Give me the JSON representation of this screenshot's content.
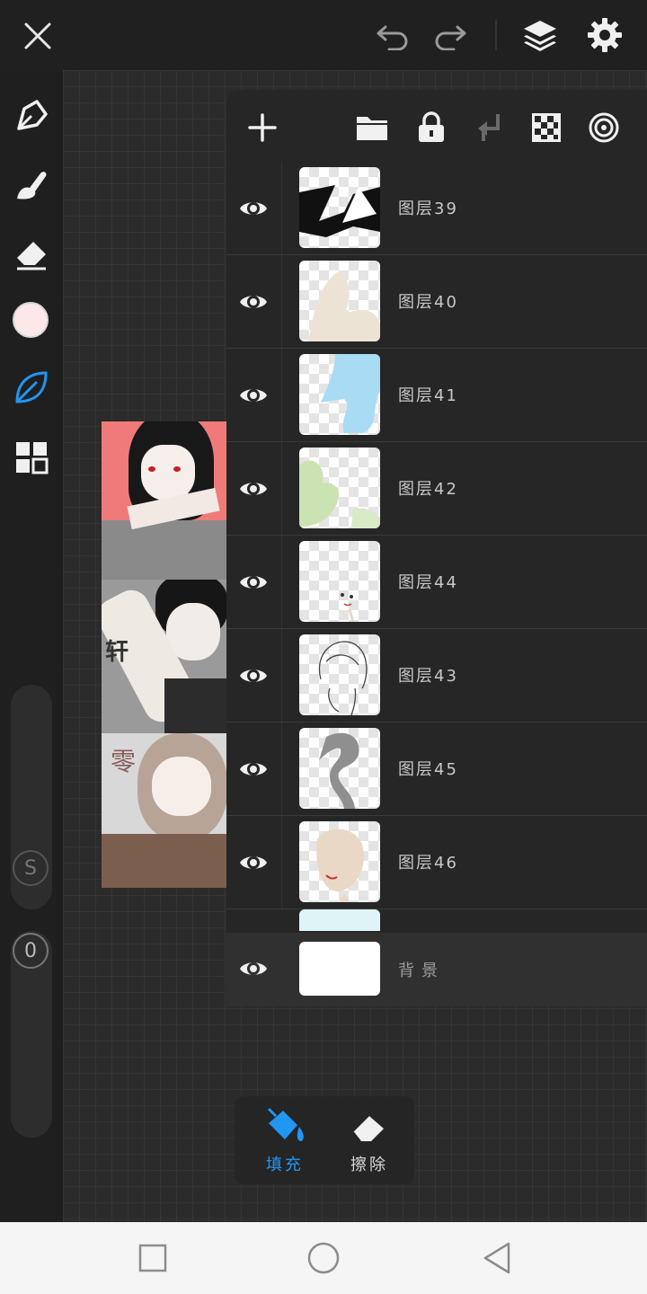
{
  "toolbar": {
    "icons": [
      "close-icon",
      "undo-icon",
      "redo-icon",
      "layers-icon",
      "settings-icon"
    ]
  },
  "tools": [
    "pen-icon",
    "brush-icon",
    "eraser-icon",
    "color-swatch",
    "leaf-icon",
    "grid-icon"
  ],
  "colors": {
    "active_tool": "#2196f3",
    "color_swatch": "#fce8e8"
  },
  "side_badges": {
    "s": "S",
    "o": "0"
  },
  "layer_panel": {
    "actions": [
      "add-layer",
      "folder",
      "lock",
      "merge-down",
      "transparency",
      "blend"
    ],
    "layers": [
      {
        "name": "图层39"
      },
      {
        "name": "图层40"
      },
      {
        "name": "图层41"
      },
      {
        "name": "图层42"
      },
      {
        "name": "图层44"
      },
      {
        "name": "图层43"
      },
      {
        "name": "图层45"
      },
      {
        "name": "图层46"
      }
    ],
    "background_label": "背景"
  },
  "artwork": {
    "captions": [
      "轩",
      "零"
    ]
  },
  "fill_popup": {
    "fill_label": "填充",
    "erase_label": "擦除",
    "active": "fill"
  }
}
